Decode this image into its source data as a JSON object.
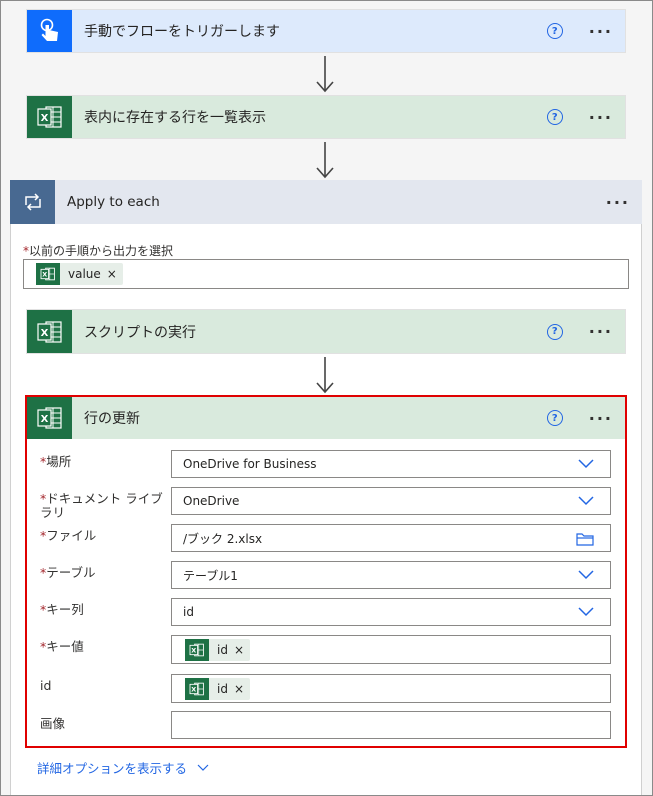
{
  "trigger": {
    "title": "手動でフローをトリガーします",
    "help": "?",
    "more": "···"
  },
  "list_rows": {
    "title": "表内に存在する行を一覧表示",
    "help": "?",
    "more": "···"
  },
  "apply_each": {
    "title": "Apply to each",
    "more": "···",
    "select_label": "以前の手順から出力を選択",
    "token": "value"
  },
  "run_script": {
    "title": "スクリプトの実行",
    "help": "?",
    "more": "···"
  },
  "update_row": {
    "title": "行の更新",
    "help": "?",
    "more": "···",
    "fields": {
      "location": {
        "label": "場所",
        "value": "OneDrive for Business"
      },
      "library": {
        "label": "ドキュメント ライブラリ",
        "value": "OneDrive"
      },
      "file": {
        "label": "ファイル",
        "value": "/ブック 2.xlsx"
      },
      "table": {
        "label": "テーブル",
        "value": "テーブル1"
      },
      "key_column": {
        "label": "キー列",
        "value": "id"
      },
      "key_value": {
        "label": "キー値",
        "token": "id"
      },
      "id": {
        "label": "id",
        "token": "id"
      },
      "image": {
        "label": "画像",
        "value": ""
      }
    },
    "advanced": "詳細オプションを表示する"
  },
  "token_close": "×",
  "colors": {
    "trigger_bg": "#ddeafc",
    "trigger_icon": "#0f6cfc",
    "excel_bg": "#d9eadd",
    "excel_icon": "#1e7145",
    "apply_bg": "#e3e7ef",
    "apply_icon": "#486991",
    "highlight": "#e00000",
    "link": "#2266e3"
  }
}
